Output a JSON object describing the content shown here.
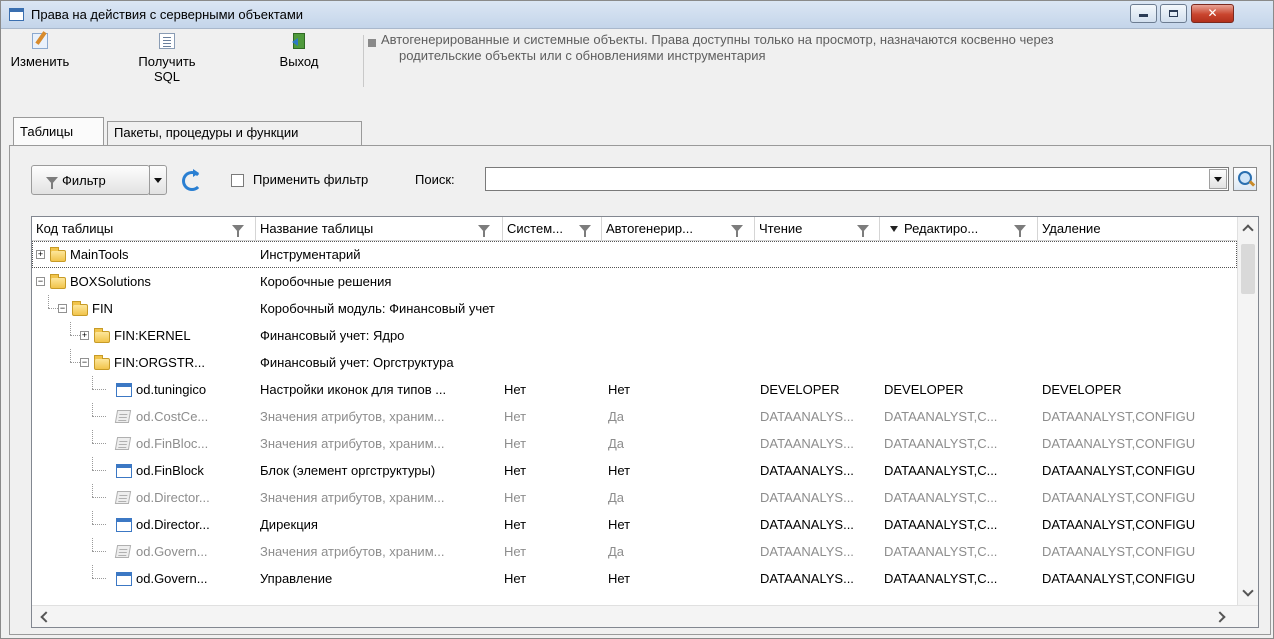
{
  "window": {
    "title": "Права на действия с серверными объектами",
    "buttons": {
      "minimize": "▬",
      "maximize": "□",
      "close": "✕"
    }
  },
  "toolbar": {
    "edit_label": "Изменить",
    "sql_label": "Получить SQL",
    "exit_label": "Выход",
    "legend_line1": "Автогенерированные и системные объекты. Права доступны только на просмотр, назначаются косвенно через",
    "legend_line2": "родительские объекты или с обновлениями инструментария"
  },
  "tabs": [
    "Таблицы",
    "Пакеты, процедуры и функции"
  ],
  "filter": {
    "button_label": "Фильтр",
    "apply_label": "Применить фильтр",
    "apply_checked": false,
    "search_label": "Поиск:",
    "search_value": ""
  },
  "grid": {
    "columns": [
      "Код таблицы",
      "Название таблицы",
      "Систем...",
      "Автогенерир...",
      "Чтение",
      "Редактиро...",
      "Удаление"
    ],
    "rows": [
      {
        "code": "MainTools",
        "name": "Инструментарий",
        "sys": "",
        "auto": "",
        "read": "",
        "edit": "",
        "del": ""
      },
      {
        "code": "BOXSolutions",
        "name": "Коробочные решения",
        "sys": "",
        "auto": "",
        "read": "",
        "edit": "",
        "del": ""
      },
      {
        "code": "FIN",
        "name": "Коробочный модуль: Финансовый учет",
        "sys": "",
        "auto": "",
        "read": "",
        "edit": "",
        "del": ""
      },
      {
        "code": "FIN:KERNEL",
        "name": "Финансовый учет: Ядро",
        "sys": "",
        "auto": "",
        "read": "",
        "edit": "",
        "del": ""
      },
      {
        "code": "FIN:ORGSTR...",
        "name": "Финансовый учет: Оргструктура",
        "sys": "",
        "auto": "",
        "read": "",
        "edit": "",
        "del": ""
      },
      {
        "code": "od.tuningico",
        "name": "Настройки иконок для типов ...",
        "sys": "Нет",
        "auto": "Нет",
        "read": "DEVELOPER",
        "edit": "DEVELOPER",
        "del": "DEVELOPER"
      },
      {
        "code": "od.CostCe...",
        "name": "Значения атрибутов, храним...",
        "sys": "Нет",
        "auto": "Да",
        "read": "DATAANALYS...",
        "edit": "DATAANALYST,C...",
        "del": "DATAANALYST,CONFIGU"
      },
      {
        "code": "od.FinBloc...",
        "name": "Значения атрибутов, храним...",
        "sys": "Нет",
        "auto": "Да",
        "read": "DATAANALYS...",
        "edit": "DATAANALYST,C...",
        "del": "DATAANALYST,CONFIGU"
      },
      {
        "code": "od.FinBlock",
        "name": "Блок (элемент оргструктуры)",
        "sys": "Нет",
        "auto": "Нет",
        "read": "DATAANALYS...",
        "edit": "DATAANALYST,C...",
        "del": "DATAANALYST,CONFIGU"
      },
      {
        "code": "od.Director...",
        "name": "Значения атрибутов, храним...",
        "sys": "Нет",
        "auto": "Да",
        "read": "DATAANALYS...",
        "edit": "DATAANALYST,C...",
        "del": "DATAANALYST,CONFIGU"
      },
      {
        "code": "od.Director...",
        "name": "Дирекция",
        "sys": "Нет",
        "auto": "Нет",
        "read": "DATAANALYS...",
        "edit": "DATAANALYST,C...",
        "del": "DATAANALYST,CONFIGU"
      },
      {
        "code": "od.Govern...",
        "name": "Значения атрибутов, храним...",
        "sys": "Нет",
        "auto": "Да",
        "read": "DATAANALYS...",
        "edit": "DATAANALYST,C...",
        "del": "DATAANALYST,CONFIGU"
      },
      {
        "code": "od.Govern...",
        "name": "Управление",
        "sys": "Нет",
        "auto": "Нет",
        "read": "DATAANALYS...",
        "edit": "DATAANALYST,C...",
        "del": "DATAANALYST,CONFIGU"
      }
    ]
  }
}
